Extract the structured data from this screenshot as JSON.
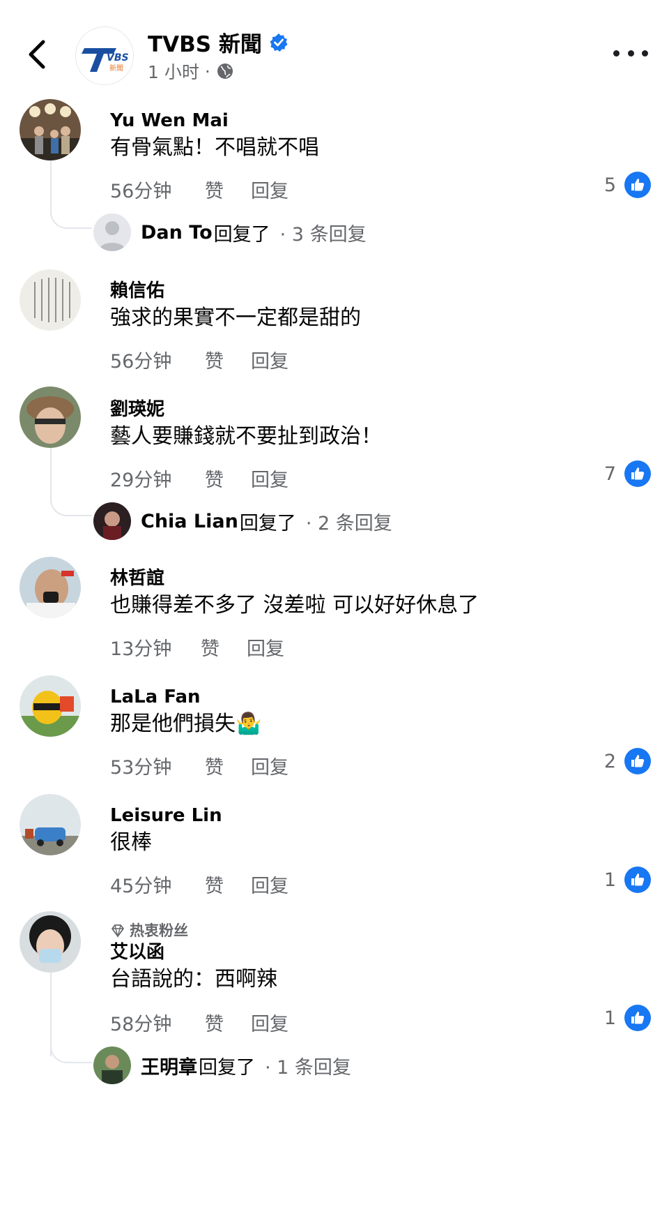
{
  "header": {
    "page_name": "TVBS 新聞",
    "post_time": "1 小时",
    "separator": "·"
  },
  "comments": [
    {
      "author": "Yu Wen Mai",
      "text": "有骨氣點！不唱就不唱",
      "time": "56分钟",
      "like_label": "赞",
      "reply_label": "回复",
      "reactions": "5",
      "replies": {
        "name": "Dan To",
        "verb": "回复了",
        "count": "· 3 条回复"
      }
    },
    {
      "author": "賴信佑",
      "text": "強求的果實不一定都是甜的",
      "time": "56分钟",
      "like_label": "赞",
      "reply_label": "回复"
    },
    {
      "author": "劉瑛妮",
      "text": "藝人要賺錢就不要扯到政治！",
      "time": "29分钟",
      "like_label": "赞",
      "reply_label": "回复",
      "reactions": "7",
      "replies": {
        "name": "Chia Lian",
        "verb": "回复了",
        "count": "· 2 条回复"
      }
    },
    {
      "author": "林哲誼",
      "text": "也賺得差不多了 沒差啦 可以好好休息了",
      "time": "13分钟",
      "like_label": "赞",
      "reply_label": "回复"
    },
    {
      "author": "LaLa Fan",
      "text": "那是他們損失🤷‍♂️",
      "time": "53分钟",
      "like_label": "赞",
      "reply_label": "回复",
      "reactions": "2"
    },
    {
      "author": "Leisure Lin",
      "text": "很棒",
      "time": "45分钟",
      "like_label": "赞",
      "reply_label": "回复",
      "reactions": "1"
    },
    {
      "author": "艾以函",
      "badge": "热衷粉丝",
      "text": "台語說的：西啊辣",
      "time": "58分钟",
      "like_label": "赞",
      "reply_label": "回复",
      "reactions": "1",
      "replies": {
        "name": "王明章",
        "verb": "回复了",
        "count": "· 1 条回复"
      }
    }
  ],
  "colors": {
    "accent": "#1877f2",
    "secondary_text": "#65676b",
    "primary_text": "#050505"
  },
  "icons": [
    "back-arrow-icon",
    "tvbs-logo",
    "verified-badge-icon",
    "globe-icon",
    "more-dots-icon",
    "like-thumb-icon",
    "diamond-fan-icon"
  ]
}
